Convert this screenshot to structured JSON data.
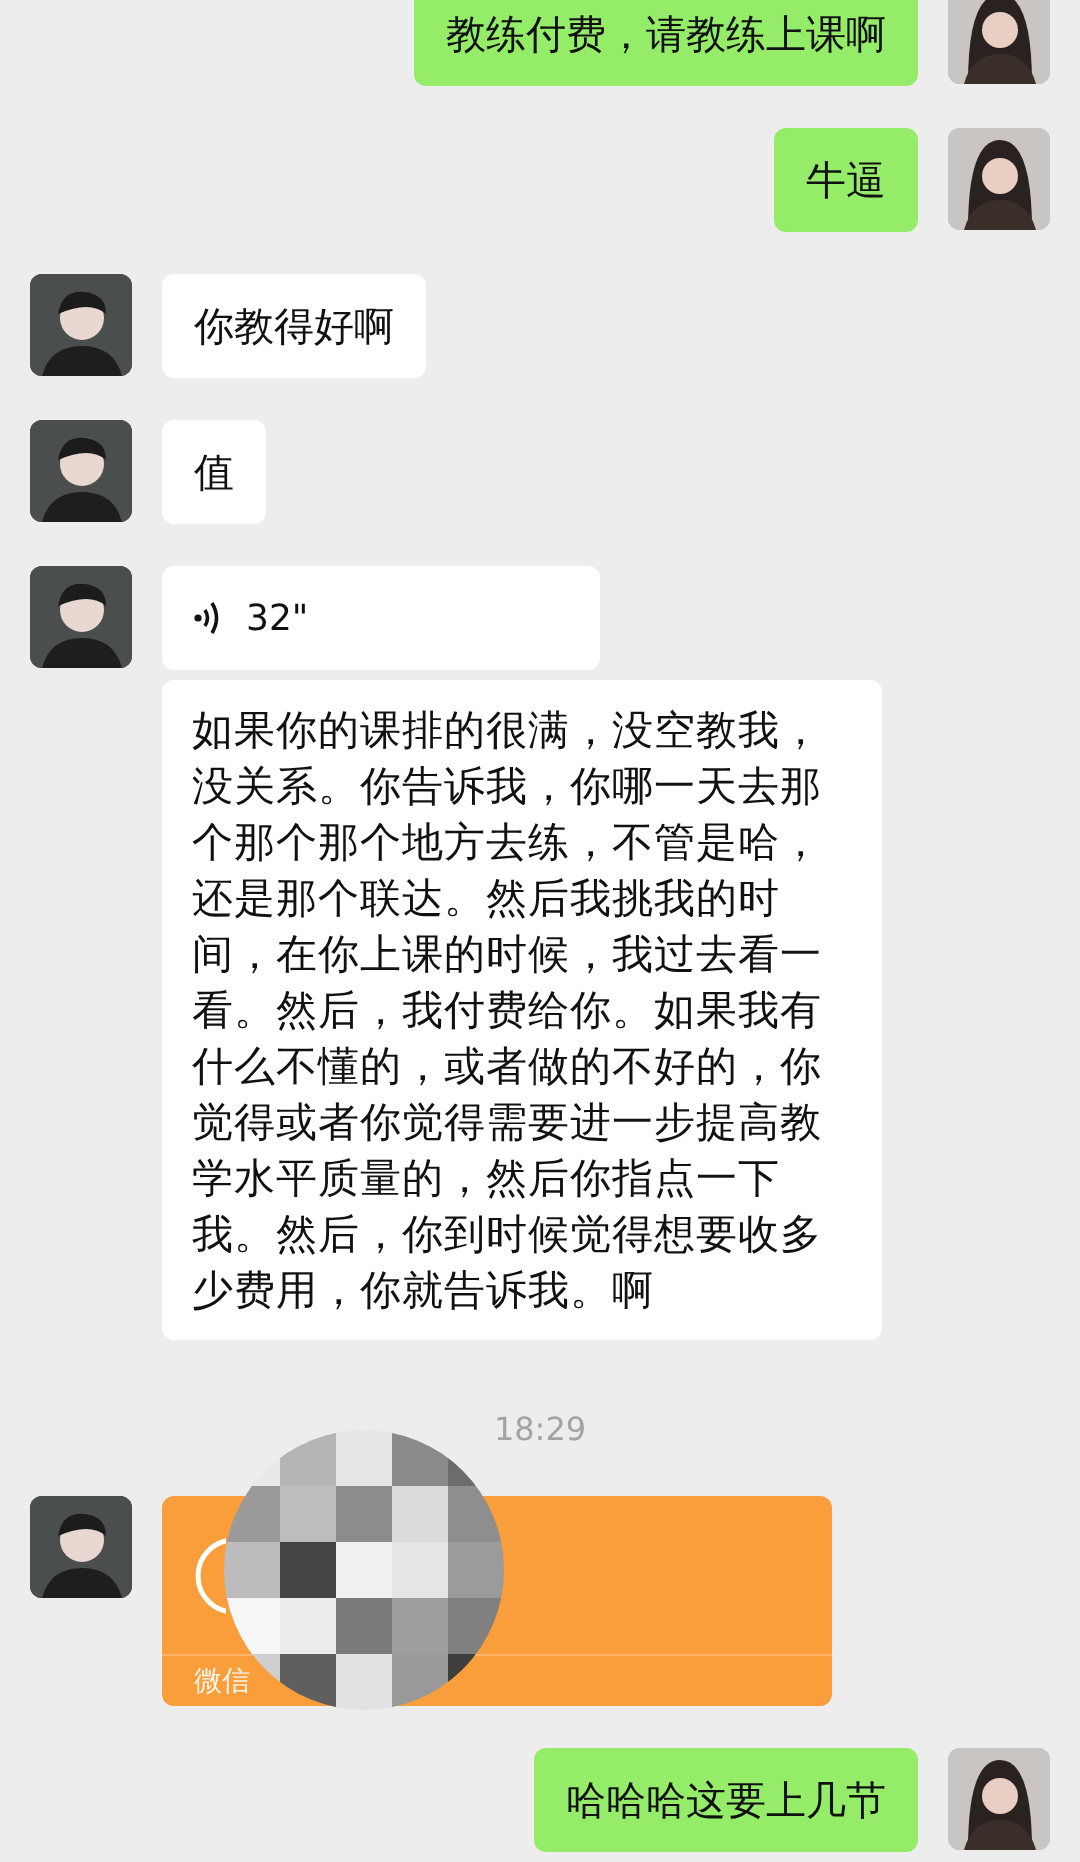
{
  "messages": [
    {
      "outgoing": true,
      "kind": "text",
      "avatar": true,
      "text": "教练付费，请教练上课啊"
    },
    {
      "outgoing": true,
      "kind": "text",
      "avatar": true,
      "text": "牛逼"
    },
    {
      "outgoing": false,
      "kind": "text",
      "avatar": true,
      "text": "你教得好啊"
    },
    {
      "outgoing": false,
      "kind": "text",
      "avatar": true,
      "text": "值"
    },
    {
      "outgoing": false,
      "kind": "voice",
      "avatar": true,
      "duration": "32\""
    },
    {
      "outgoing": false,
      "kind": "text",
      "avatar": false,
      "text": "如果你的课排的很满，没空教我，没关系。你告诉我，你哪一天去那个那个那个地方去练，不管是哈，还是那个联达。然后我挑我的时间，在你上课的时候，我过去看一看。然后，我付费给你。如果我有什么不懂的，或者做的不好的，你觉得或者你觉得需要进一步提高教学水平质量的，然后你指点一下我。然后，你到时候觉得想要收多少费用，你就告诉我。啊"
    },
    {
      "kind": "time",
      "text": "18:29"
    },
    {
      "outgoing": false,
      "kind": "transfer",
      "avatar": true,
      "label": "微信"
    },
    {
      "outgoing": true,
      "kind": "text",
      "avatar": true,
      "text": "哈哈哈这要上几节"
    }
  ]
}
